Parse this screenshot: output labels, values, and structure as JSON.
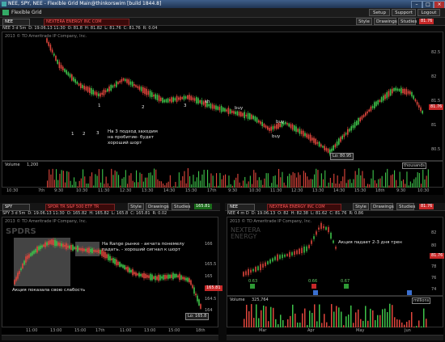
{
  "window": {
    "title": "NEE, SPY, NEE - Flexible Grid Main@thinkorswim [build 1844.8]",
    "controls": [
      "–",
      "□",
      "×"
    ]
  },
  "menubar": {
    "label": "Flexible Grid",
    "buttons": {
      "setup": "Setup",
      "support": "Support",
      "logout": "Logout"
    }
  },
  "top_pane": {
    "symbol": "NEE",
    "company": "NEXTERA ENERGY INC COM",
    "style": "Style",
    "drawings": "Drawings",
    "studies": "Studies",
    "last_price": "81.76",
    "quote": {
      "period": "NEE 3 d 5m",
      "date": "D: 19.06.13 11:30",
      "open": "O: 81.8",
      "high": "H: 81.82",
      "low": "L: 81.76",
      "close": "C: 81.76",
      "change": "R: 0.04"
    },
    "copyright": "2013 © TD Ameritrade IP Company, Inc.",
    "price_axis": [
      "82.5",
      "82",
      "81.5",
      "81",
      "80.5"
    ],
    "price_label": "81.76",
    "low_label": "Lo: 80.95",
    "time_axis": [
      "10:30",
      "7th",
      "9:30",
      "10:30",
      "11:30",
      "12:30",
      "13:30",
      "14:30",
      "15:30",
      "17th",
      "9:30",
      "10:30",
      "11:30",
      "12:30",
      "13:30",
      "14:30",
      "15:30",
      "18th",
      "9:30",
      "10:30"
    ],
    "volume_label": "Volume",
    "volume_value": "1,200",
    "volume_tag": "thousands",
    "annotations": {
      "note": "На 3 подход заходим\nна пробитие- будет\nхороший шорт",
      "buy1": "buy",
      "buy2": "buy",
      "buy3": "buy",
      "sh": "sh",
      "nums": [
        "1",
        "2",
        "3",
        "1",
        "2",
        "3"
      ]
    }
  },
  "left_pane": {
    "symbol": "SPY",
    "company": "SPDR TR S&P 500 ETF TR",
    "style": "Style",
    "drawings": "Drawings",
    "studies": "Studies",
    "last_price": "165.81",
    "quote": {
      "period": "SPY 3 d 5m",
      "date": "D: 19.06.13 11:30",
      "open": "O: 165.82",
      "high": "H: 165.82",
      "low": "L: 165.8",
      "close": "C: 165.81",
      "change": "R: 0.02"
    },
    "copyright": "2013 © TD Ameritrade IP Company, Inc.",
    "logo": "SPDRS",
    "price_axis": [
      "166",
      "165.5",
      "165",
      "164.5",
      "164"
    ],
    "price_label": "165.81",
    "low_label": "Lo: 165.8",
    "time_axis": [
      "11:00",
      "13:00",
      "15:00",
      "17th",
      "11:00",
      "13:00",
      "15:00",
      "18th"
    ],
    "notes": {
      "range": "На Range рынке - акчата понемелу\nпадать. - хороший сигнал к шорт",
      "weak": "Акция показала свою слабость"
    }
  },
  "right_pane": {
    "symbol": "NEE",
    "company": "NEXTERA ENERGY INC COM",
    "style": "Style",
    "drawings": "Drawings",
    "studies": "Studies",
    "last_price": "81.76",
    "quote": {
      "period": "NEE 4 m D",
      "date": "D: 19.06.13",
      "open": "O: 82",
      "high": "H: 82.38",
      "low": "L: 81.62",
      "close": "C: 81.76",
      "change": "R: 0.86"
    },
    "copyright": "2013 © TD Ameritrade IP Company, Inc.",
    "logo": "NEXTERA ENERGY",
    "price_axis": [
      "82",
      "80",
      "78",
      "76",
      "74"
    ],
    "price_label": "81.76",
    "note": "Акция падает 2-3 дня трен",
    "events": [
      "0.63",
      "0.66",
      "0.67"
    ],
    "time_axis": [
      "Mar",
      "Apr",
      "May",
      "Jun"
    ],
    "volume_label": "Volume",
    "volume_value": "325,764",
    "volume_tag": "millions"
  },
  "colors": {
    "bull": "#3ec34a",
    "bear": "#e0463c",
    "panel": "#000000",
    "accent_red": "#c62828"
  }
}
